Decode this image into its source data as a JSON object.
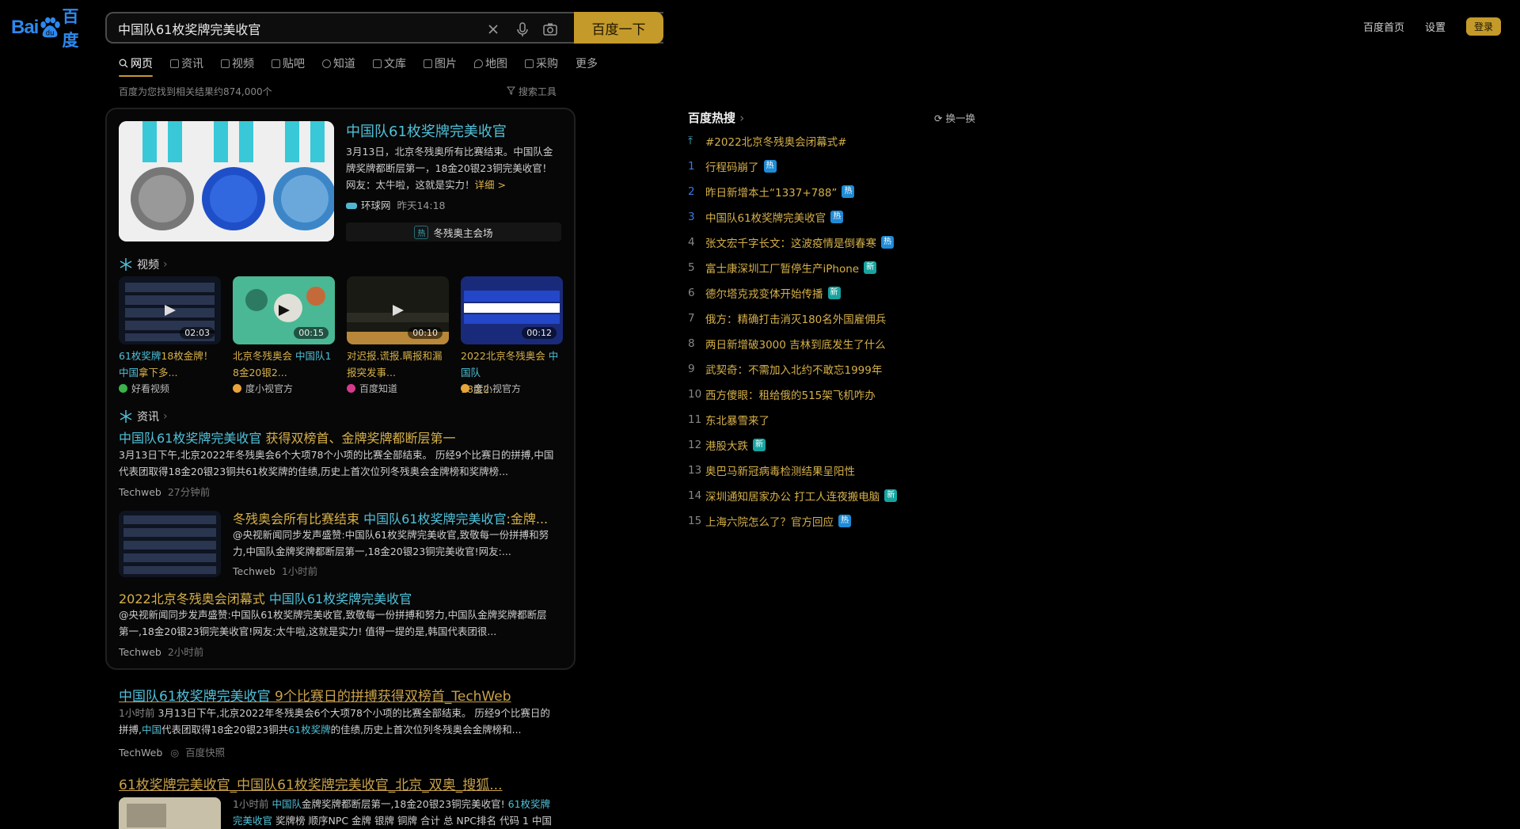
{
  "header": {
    "logo_left": "Bai",
    "logo_right": "百度",
    "query": "中国队61枚奖牌完美收官",
    "search_button": "百度一下",
    "links": [
      "百度首页",
      "设置"
    ],
    "login": "登录"
  },
  "tabs": [
    "网页",
    "资讯",
    "视频",
    "贴吧",
    "知道",
    "文库",
    "图片",
    "地图",
    "采购",
    "更多"
  ],
  "result_count": "百度为您找到相关结果约874,000个",
  "search_tools": "搜索工具",
  "main_card": {
    "title": "中国队61枚奖牌完美收官",
    "desc": "3月13日，北京冬残奥所有比赛结束。中国队金牌奖牌都断层第一，18金20银23铜完美收官！网友：太牛啦，这就是实力！",
    "more": "详细 >",
    "source": "环球网",
    "time": "昨天14:18",
    "hot_tag": "热",
    "hot_label": "冬残奥主会场"
  },
  "video_section": {
    "heading": "视频",
    "items": [
      {
        "title_hl": "61枚奖牌",
        "title_rest": "18枚金牌！",
        "title2_hl": "中国",
        "title2_rest": "拿下多...",
        "duration": "02:03",
        "source": "好看视频"
      },
      {
        "title_hl": "",
        "title_rest": "北京冬残奥会 ",
        "title2_hl": "中国队1",
        "title2_rest": "8金20银2...",
        "duration": "00:15",
        "source": "度小视官方"
      },
      {
        "title_hl": "",
        "title_rest": "对迟报.谎报.瞒报和漏",
        "title2_hl": "",
        "title2_rest": "报突发事...",
        "duration": "00:10",
        "source": "百度知道"
      },
      {
        "title_hl": "",
        "title_rest": "2022北京冬残奥会 ",
        "title2_hl": "中国队",
        "title2_rest": "18金2...",
        "duration": "00:12",
        "source": "度小视官方"
      }
    ]
  },
  "news_section": {
    "heading": "资讯",
    "items": [
      {
        "title_hl": "中国队61枚奖牌完美收官",
        "title_rest": " 获得双榜首、金牌奖牌都断层第一",
        "desc1": "3月13日下午,北京2022年冬残奥会6个大项78个小项的比赛全部结束。 历经9个比赛日的拼搏,中国",
        "desc2": "代表团取得18金20银23铜共61枚奖牌的佳绩,历史上首次位列冬残奥会金牌榜和奖牌榜...",
        "source": "Techweb",
        "time": "27分钟前"
      },
      {
        "title_pre": "冬残奥会所有比赛结束 ",
        "title_hl": "中国队61枚奖牌完美收官",
        "title_rest": ":金牌...",
        "desc1": "@央视新闻同步发声盛赞:中国队61枚奖牌完美收官,致敬每一份拼搏和努",
        "desc2": "力,中国队金牌奖牌都断层第一,18金20银23铜完美收官!网友:...",
        "source": "Techweb",
        "time": "1小时前"
      },
      {
        "title_pre": "2022北京冬残奥会闭幕式 ",
        "title_hl": "中国队61枚奖牌完美收官",
        "title_rest": "",
        "desc1": "@央视新闻同步发声盛赞:中国队61枚奖牌完美收官,致敬每一份拼搏和努力,中国队金牌奖牌都断层",
        "desc2": "第一,18金20银23铜完美收官!网友:太牛啦,这就是实力! 值得一提的是,韩国代表团很...",
        "source": "Techweb",
        "time": "2小时前"
      }
    ]
  },
  "result1": {
    "title_hl": "中国队61枚奖牌完美收官",
    "title_rest": " 9个比赛日的拼搏获得双榜首_TechWeb",
    "time": "1小时前",
    "desc1": "3月13日下午,北京2022年冬残奥会6个大项78个小项的比赛全部结束。 历经9个比赛日的",
    "desc2a": "拼搏,",
    "desc2b": "中国",
    "desc2c": "代表团取得18金20银23铜共",
    "desc2d": "61枚奖牌",
    "desc2e": "的佳绩,历史上首次位列冬残奥会金牌榜和...",
    "source": "TechWeb",
    "snapshot": "百度快照"
  },
  "result2": {
    "title": "61枚奖牌完美收官_中国队61枚奖牌完美收官_北京_双奥_搜狐...",
    "time": "1小时前",
    "d_hl": "中国队",
    "d_rest": "金牌奖牌都断层第一,18金20银23铜完美收官! ",
    "d_hl2": "61枚奖牌",
    "line2_hl": "完美收官",
    "line2_rest": " 奖牌榜 顺序NPC 金牌 银牌 铜牌 合计 总 NPC排名 代码 1 中国"
  },
  "hot": {
    "title": "百度热搜",
    "refresh": "换一换",
    "items": [
      {
        "n": "",
        "text": "#2022北京冬残奥会闭幕式#",
        "badge": ""
      },
      {
        "n": "1",
        "text": "行程码崩了",
        "badge": "热"
      },
      {
        "n": "2",
        "text": "昨日新增本土“1337+788”",
        "badge": "热"
      },
      {
        "n": "3",
        "text": "中国队61枚奖牌完美收官",
        "badge": "热"
      },
      {
        "n": "4",
        "text": "张文宏千字长文：这波疫情是倒春寒",
        "badge": "热"
      },
      {
        "n": "5",
        "text": "富士康深圳工厂暂停生产iPhone",
        "badge": "新"
      },
      {
        "n": "6",
        "text": "德尔塔克戎变体开始传播",
        "badge": "新"
      },
      {
        "n": "7",
        "text": "俄方：精确打击消灭180名外国雇佣兵",
        "badge": ""
      },
      {
        "n": "8",
        "text": "两日新增破3000 吉林到底发生了什么",
        "badge": ""
      },
      {
        "n": "9",
        "text": "武契奇：不需加入北约不敢忘1999年",
        "badge": ""
      },
      {
        "n": "10",
        "text": "西方傻眼：租给俄的515架飞机咋办",
        "badge": ""
      },
      {
        "n": "11",
        "text": "东北暴雪来了",
        "badge": ""
      },
      {
        "n": "12",
        "text": "港股大跌",
        "badge": "新"
      },
      {
        "n": "13",
        "text": "奥巴马新冠病毒检测结果呈阳性",
        "badge": ""
      },
      {
        "n": "14",
        "text": "深圳通知居家办公 打工人连夜搬电脑",
        "badge": "新"
      },
      {
        "n": "15",
        "text": "上海六院怎么了？官方回应",
        "badge": "热"
      }
    ]
  }
}
